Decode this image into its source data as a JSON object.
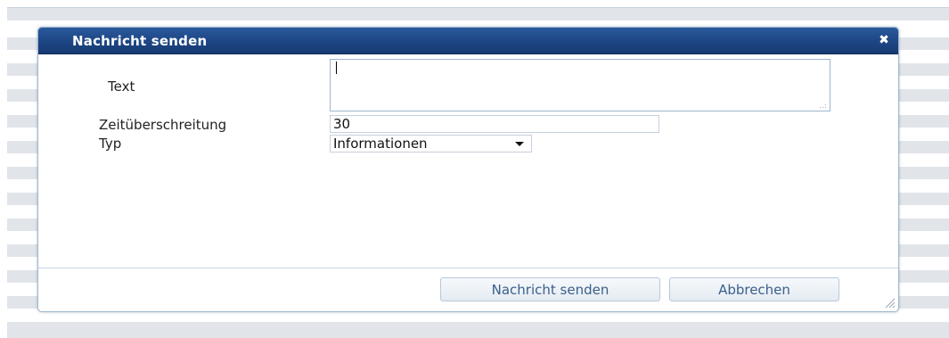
{
  "dialog": {
    "title": "Nachricht senden",
    "close_icon": "close-icon"
  },
  "form": {
    "text_label": "Text",
    "text_value": "",
    "timeout_label": "Zeitüberschreitung",
    "timeout_value": "30",
    "type_label": "Typ",
    "type_selected": "Informationen"
  },
  "buttons": {
    "send_label": "Nachricht senden",
    "cancel_label": "Abbrechen"
  },
  "colors": {
    "titlebar": "#1d4584",
    "button_text": "#3a5f8a",
    "border": "#9fb6cf"
  }
}
